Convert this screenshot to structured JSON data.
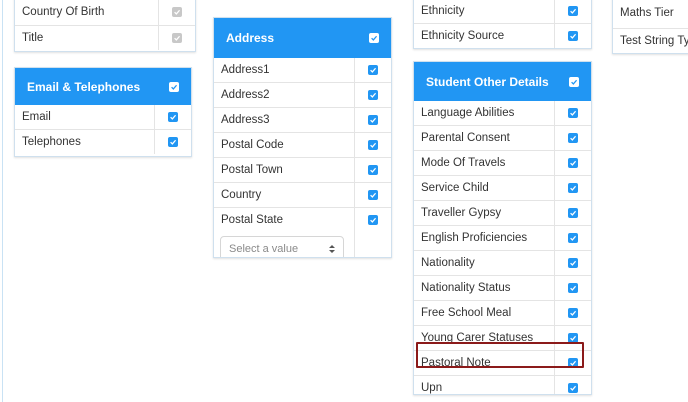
{
  "col1": {
    "top_card_rows": [
      {
        "label": "Country Of Birth",
        "checked": true,
        "disabled": true
      },
      {
        "label": "Title",
        "checked": true,
        "disabled": true
      }
    ],
    "email_card": {
      "title": "Email & Telephones",
      "rows": [
        {
          "label": "Email",
          "checked": true
        },
        {
          "label": "Telephones",
          "checked": true
        }
      ]
    }
  },
  "address_card": {
    "title": "Address",
    "rows": [
      {
        "label": "Address1",
        "checked": true
      },
      {
        "label": "Address2",
        "checked": true
      },
      {
        "label": "Address3",
        "checked": true
      },
      {
        "label": "Postal Code",
        "checked": true
      },
      {
        "label": "Postal Town",
        "checked": true
      },
      {
        "label": "Country",
        "checked": true
      },
      {
        "label": "Postal State",
        "checked": true
      }
    ],
    "select": {
      "placeholder": "Select a value"
    }
  },
  "col3": {
    "top_card_rows": [
      {
        "label": "Ethnicity",
        "checked": true
      },
      {
        "label": "Ethnicity Source",
        "checked": true
      }
    ],
    "student_card": {
      "title": "Student Other Details",
      "rows": [
        {
          "label": "Language Abilities",
          "checked": true
        },
        {
          "label": "Parental Consent",
          "checked": true
        },
        {
          "label": "Mode Of Travels",
          "checked": true
        },
        {
          "label": "Service Child",
          "checked": true
        },
        {
          "label": "Traveller Gypsy",
          "checked": true
        },
        {
          "label": "English Proficiencies",
          "checked": true
        },
        {
          "label": "Nationality",
          "checked": true
        },
        {
          "label": "Nationality Status",
          "checked": true
        },
        {
          "label": "Free School Meal",
          "checked": true
        },
        {
          "label": "Young Carer Statuses",
          "checked": true
        },
        {
          "label": "Pastoral Note",
          "checked": true,
          "highlighted": true
        },
        {
          "label": "Upn",
          "checked": true
        }
      ]
    }
  },
  "col4": {
    "top_card_rows": [
      {
        "label": "Maths Tier"
      },
      {
        "label": "Test String Typ"
      }
    ]
  },
  "colors": {
    "header_blue": "#2196f3",
    "highlight_red": "#8b1a1a",
    "disabled_gray": "#c8c8c8"
  }
}
